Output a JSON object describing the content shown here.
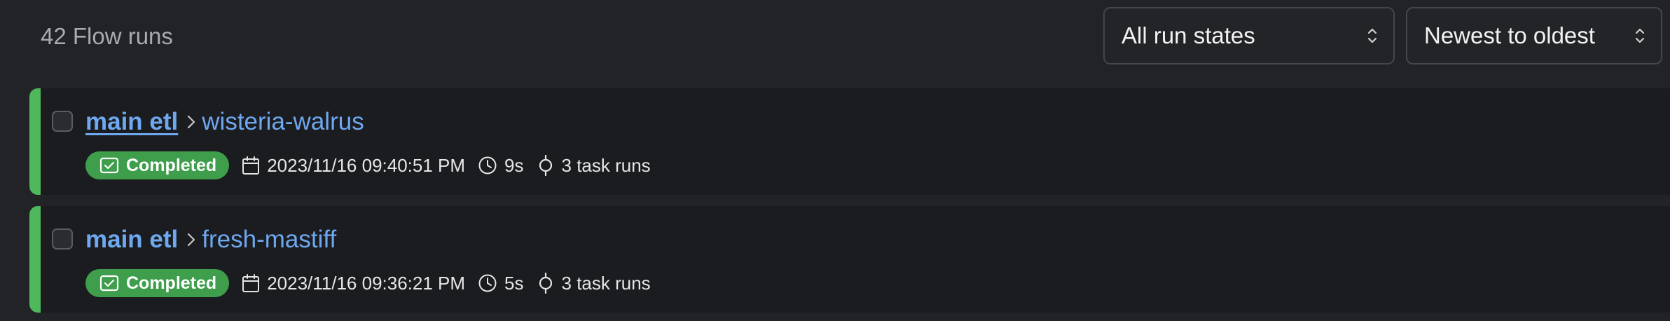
{
  "header": {
    "run_count": "42 Flow runs",
    "state_filter": "All run states",
    "sort_order": "Newest to oldest"
  },
  "colors": {
    "completed_bar": "#4fb85c",
    "completed_badge": "#3f9e4c",
    "link": "#6ea8f0"
  },
  "runs": [
    {
      "flow_name": "main etl",
      "run_name": "wisteria-walrus",
      "state": "Completed",
      "start_time": "2023/11/16 09:40:51 PM",
      "duration": "9s",
      "task_runs": "3 task runs"
    },
    {
      "flow_name": "main etl",
      "run_name": "fresh-mastiff",
      "state": "Completed",
      "start_time": "2023/11/16 09:36:21 PM",
      "duration": "5s",
      "task_runs": "3 task runs"
    }
  ]
}
